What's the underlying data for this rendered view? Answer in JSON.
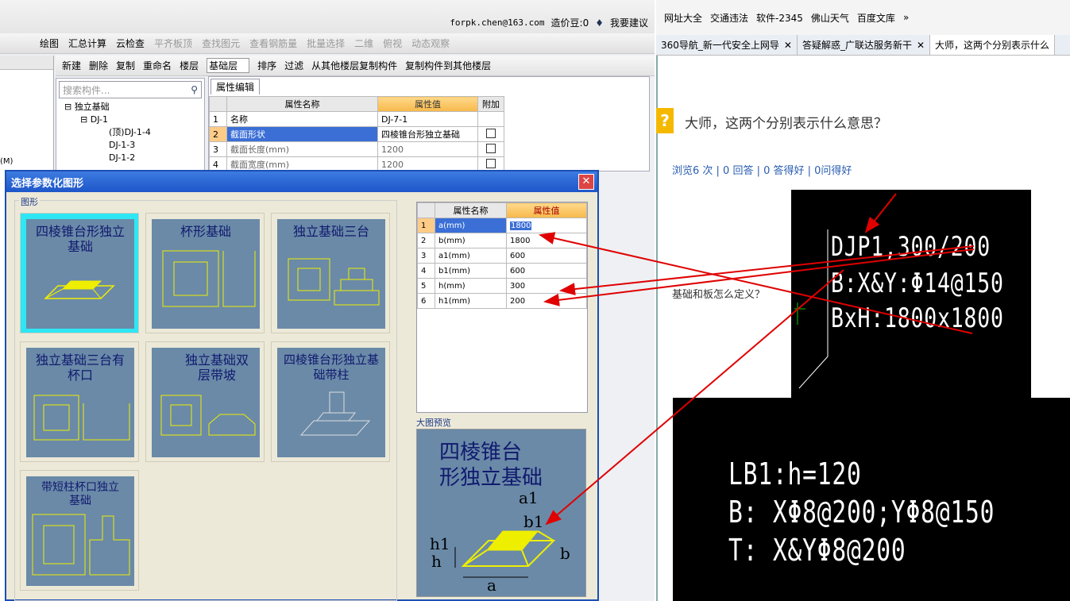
{
  "app": {
    "account": "forpk.chen@163.com",
    "price_beans": "造价豆:0",
    "suggest": "我要建议",
    "toolbar1": [
      "绘图",
      "汇总计算",
      "云检查",
      "平齐板顶",
      "查找图元",
      "查看钢筋量",
      "批量选择",
      "二维",
      "俯视",
      "动态观察"
    ],
    "toolbar2": [
      "新建",
      "删除",
      "复制",
      "重命名",
      "楼层",
      "基础层",
      "排序",
      "过滤",
      "从其他楼层复制构件",
      "复制构件到其他楼层"
    ]
  },
  "tree": {
    "search_placeholder": "搜索构件...",
    "root": "独立基础",
    "child": "DJ-1",
    "items": [
      "(顶)DJ-1-4",
      "DJ-1-3",
      "DJ-1-2"
    ]
  },
  "left_panel": {
    "label": "(M)"
  },
  "properties": {
    "tab": "属性编辑",
    "headers": [
      "属性名称",
      "属性值",
      "附加"
    ],
    "rows": [
      {
        "num": "1",
        "name": "名称",
        "value": "DJ-7-1"
      },
      {
        "num": "2",
        "name": "截面形状",
        "value": "四棱锥台形独立基础"
      },
      {
        "num": "3",
        "name": "截面长度(mm)",
        "value": "1200"
      },
      {
        "num": "4",
        "name": "截面宽度(mm)",
        "value": "1200"
      }
    ]
  },
  "dialog": {
    "title": "选择参数化图形",
    "group_label": "图形",
    "shapes": [
      "四棱锥台形独立基础",
      "杯形基础",
      "独立基础三台",
      "独立基础三台有杯口",
      "独立基础双层带坡",
      "四棱锥台形独立基础带柱",
      "带短柱杯口独立基础"
    ],
    "param_headers": [
      "属性名称",
      "属性值"
    ],
    "params": [
      {
        "num": "1",
        "name": "a(mm)",
        "value": "1800"
      },
      {
        "num": "2",
        "name": "b(mm)",
        "value": "1800"
      },
      {
        "num": "3",
        "name": "a1(mm)",
        "value": "600"
      },
      {
        "num": "4",
        "name": "b1(mm)",
        "value": "600"
      },
      {
        "num": "5",
        "name": "h(mm)",
        "value": "300"
      },
      {
        "num": "6",
        "name": "h1(mm)",
        "value": "200"
      }
    ],
    "preview_label": "大图预览",
    "preview_title_1": "四棱锥台",
    "preview_title_2": "形独立基础",
    "dims": {
      "a": "a",
      "b": "b",
      "a1": "a1",
      "b1": "b1",
      "h": "h",
      "h1": "h1"
    }
  },
  "browser": {
    "bookmarks": [
      "网址大全",
      "交通违法",
      "软件-2345",
      "佛山天气",
      "百度文库"
    ],
    "tabs": [
      {
        "label": "360导航_新一代安全上网导",
        "active": false
      },
      {
        "label": "答疑解惑_广联达服务新干",
        "active": false
      },
      {
        "label": "大师，这两个分别表示什么",
        "active": true
      }
    ],
    "question": "大师，这两个分别表示什么意思？",
    "stats": "浏览6 次 | 0 回答 | 0 答得好 | 0问得好",
    "side_text": "基础和板怎么定义？",
    "cad1_lines": [
      "DJP1,300/200",
      "B:X&Y:Φ14@150",
      "BxH:1800x1800"
    ],
    "cad2_lines": [
      "LB1:h=120",
      "B: XΦ8@200;YΦ8@150",
      "T: X&YΦ8@200"
    ]
  },
  "colors": {
    "arrow": "#e00000",
    "dialog_title": "#1d56c9",
    "card_selected": "#2ee6f4",
    "header_value": "#f7b84a"
  }
}
